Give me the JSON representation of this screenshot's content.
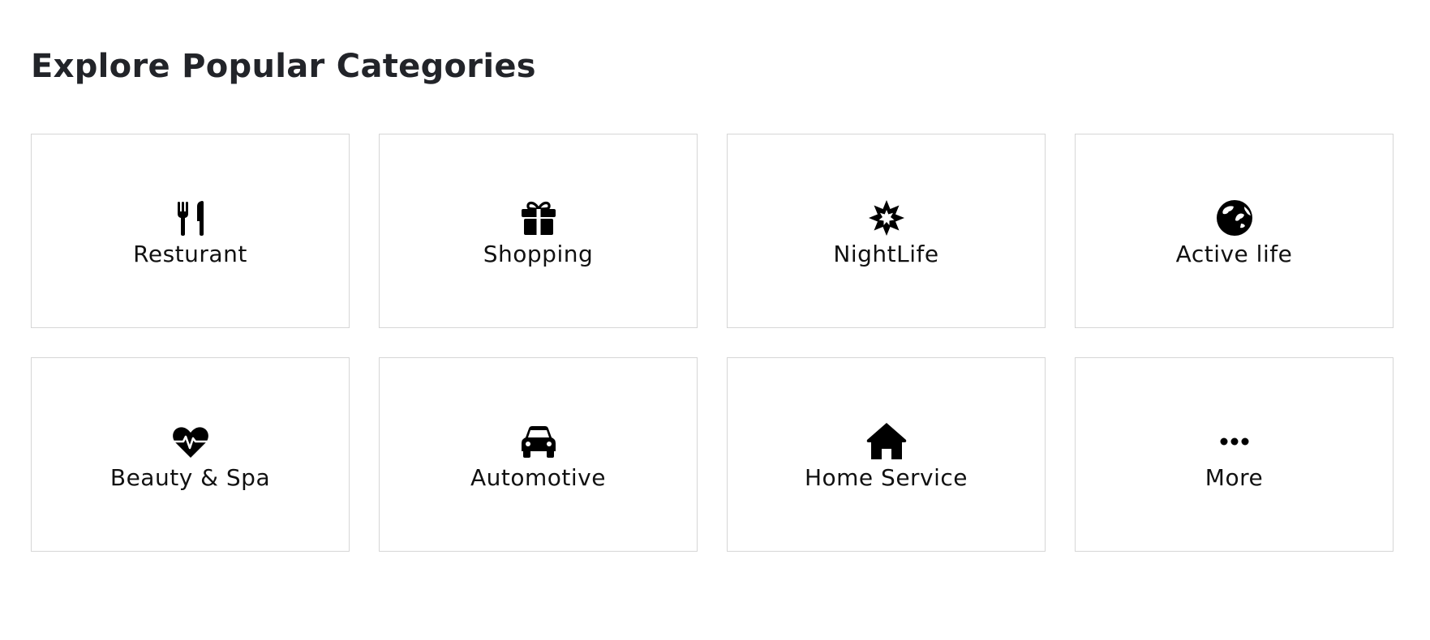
{
  "section": {
    "title": "Explore Popular Categories"
  },
  "categories": [
    {
      "label": "Resturant",
      "icon": "utensils-icon"
    },
    {
      "label": "Shopping",
      "icon": "gift-icon"
    },
    {
      "label": "NightLife",
      "icon": "burst-icon"
    },
    {
      "label": "Active life",
      "icon": "globe-icon"
    },
    {
      "label": "Beauty & Spa",
      "icon": "heartbeat-icon"
    },
    {
      "label": "Automotive",
      "icon": "car-icon"
    },
    {
      "label": "Home Service",
      "icon": "home-icon"
    },
    {
      "label": "More",
      "icon": "ellipsis-icon"
    }
  ],
  "colors": {
    "title": "#222429",
    "text": "#111111",
    "card_border": "#d6d6d6",
    "background": "#ffffff"
  }
}
